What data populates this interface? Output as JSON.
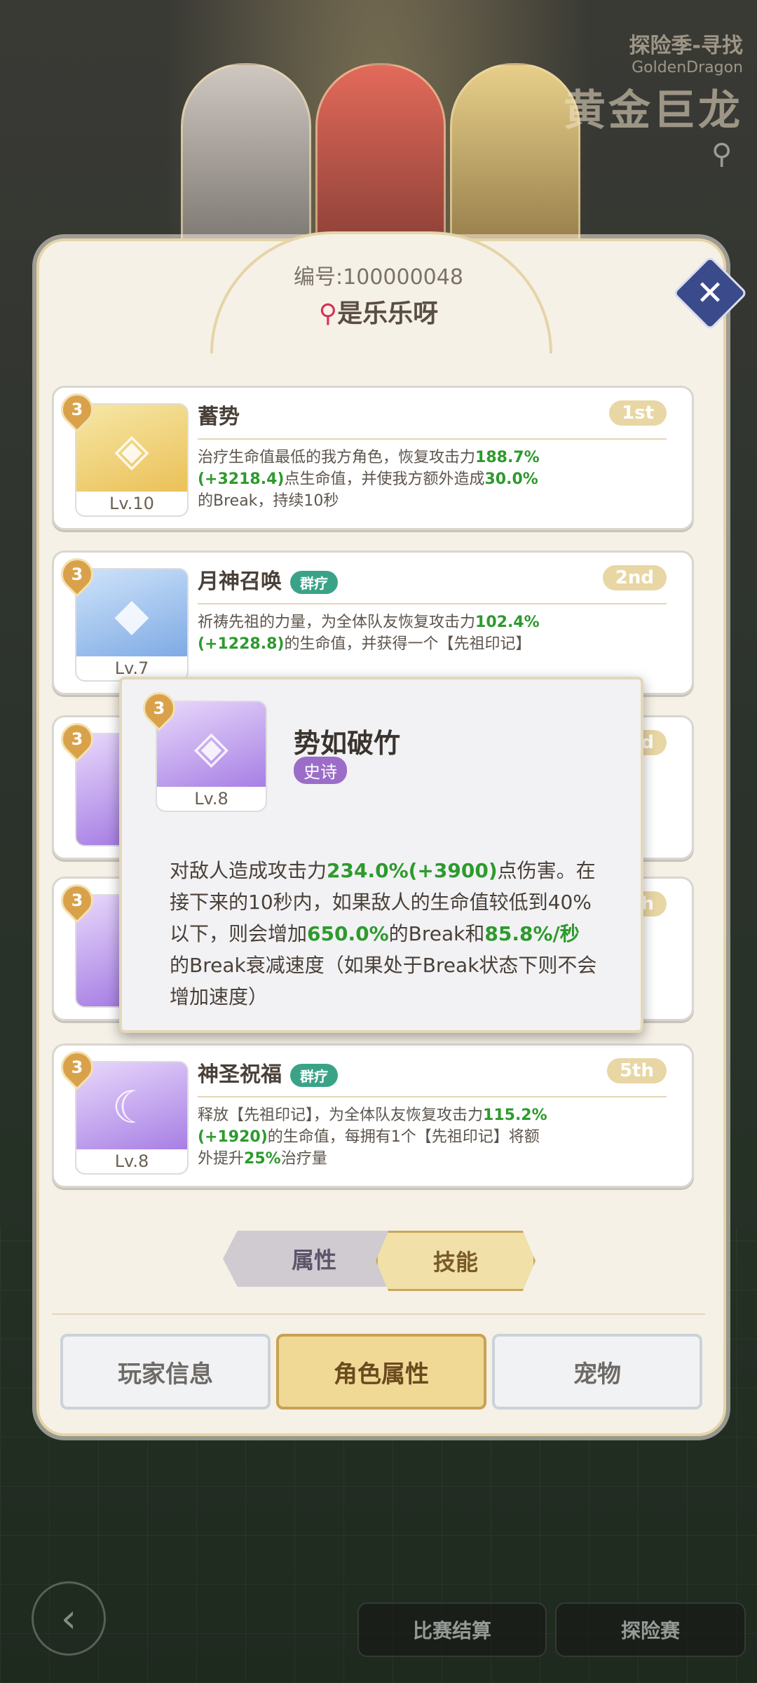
{
  "header": {
    "event_sub1": "探险季-寻找",
    "event_sub2": "GoldenDragon",
    "event_main": "黄金巨龙"
  },
  "player": {
    "uid": "编号:100000048",
    "name": "是乐乐呀"
  },
  "skills": [
    {
      "name": "蓄势",
      "tag": "",
      "rank": "1st",
      "level": "Lv.10",
      "stars": "3",
      "desc": [
        "治疗生命值最低的我方角色，恢复攻击力",
        "188.7%(+3218.4)",
        "点生命值，并使我方额外造成",
        "30.0%",
        "的Break，持续10秒"
      ]
    },
    {
      "name": "月神召唤",
      "tag": "群疗",
      "rank": "2nd",
      "level": "Lv.7",
      "stars": "3",
      "desc": [
        "祈祷先祖的力量，为全体队友恢复攻击力",
        "102.4%(+1228.8)",
        "的生命值，并获得一个【先祖印记】"
      ]
    },
    {
      "stars": "3",
      "rank_partial": "d"
    },
    {
      "stars": "3",
      "rank_partial": "h"
    },
    {
      "name": "神圣祝福",
      "tag": "群疗",
      "rank": "5th",
      "level": "Lv.8",
      "stars": "3",
      "desc": [
        "释放【先祖印记】，为全体队友恢复攻击力",
        "115.2%(+1920)",
        "的生命值，每拥有1个【先祖印记】将额外提升",
        "25%",
        "治疗量"
      ]
    }
  ],
  "popup": {
    "name": "势如破竹",
    "tag": "史诗",
    "level": "Lv.8",
    "stars": "3",
    "desc": [
      "对敌人造成攻击力",
      "234.0%(+3900)",
      "点伤害。在接下来的10秒内，如果敌人的生命值较低到40%以下，则会增加",
      "650.0%",
      "的Break和",
      "85.8%/秒",
      "的Break衰减速度（如果处于Break状态下则不会增加速度）"
    ]
  },
  "toggle": {
    "left": "属性",
    "right": "技能"
  },
  "tabs": [
    "玩家信息",
    "角色属性",
    "宠物"
  ],
  "bottom": {
    "settle": "比赛结算",
    "adventure": "探险赛"
  },
  "colors": {
    "highlight": "#2d9a2d",
    "gold": "#f0d995",
    "tag_green": "#3aa387",
    "tag_purple": "#9b6dc9"
  }
}
